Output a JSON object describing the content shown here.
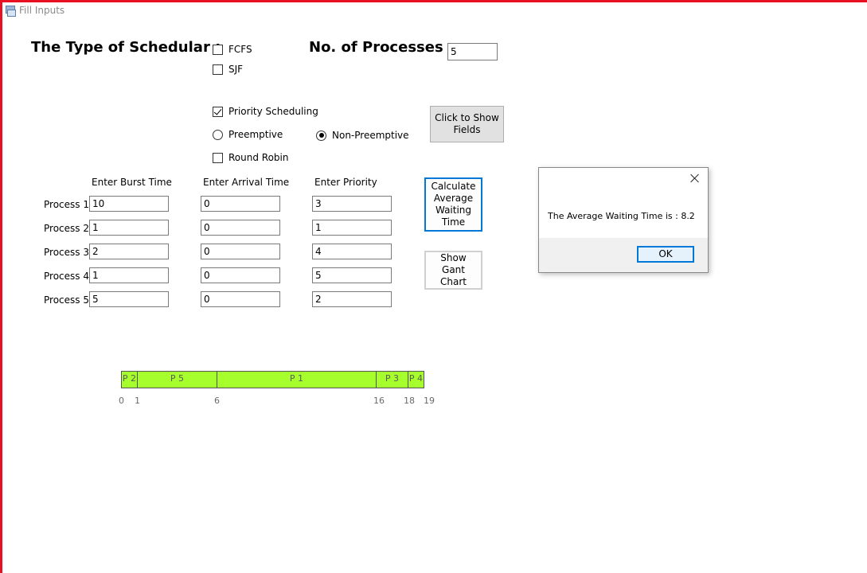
{
  "window": {
    "title": "Fill Inputs"
  },
  "scheduler": {
    "heading": "The Type of Schedular :",
    "options": {
      "fcfs": {
        "label": "FCFS",
        "checked": false
      },
      "sjf": {
        "label": "SJF",
        "checked": false
      },
      "priority": {
        "label": "Priority Scheduling",
        "checked": true
      },
      "preemptive": {
        "label": "Preemptive",
        "selected": false
      },
      "non_preemptive": {
        "label": "Non-Preemptive",
        "selected": true
      },
      "round_robin": {
        "label": "Round Robin",
        "checked": false
      }
    }
  },
  "processes_count": {
    "heading": "No. of Processes :",
    "value": "5"
  },
  "buttons": {
    "show_fields": "Click to Show Fields",
    "calculate": "Calculate Average Waiting Time",
    "gantt": "Show Gant Chart"
  },
  "table": {
    "headers": {
      "burst": "Enter Burst Time",
      "arrival": "Enter Arrival Time",
      "priority": "Enter Priority"
    },
    "rows": [
      {
        "label": "Process 1",
        "burst": "10",
        "arrival": "0",
        "priority": "3"
      },
      {
        "label": "Process 2",
        "burst": "1",
        "arrival": "0",
        "priority": "1"
      },
      {
        "label": "Process 3",
        "burst": "2",
        "arrival": "0",
        "priority": "4"
      },
      {
        "label": "Process 4",
        "burst": "1",
        "arrival": "0",
        "priority": "5"
      },
      {
        "label": "Process 5",
        "burst": "5",
        "arrival": "0",
        "priority": "2"
      }
    ]
  },
  "gantt": {
    "segments": [
      {
        "label": "P 2",
        "start": 0,
        "end": 1
      },
      {
        "label": "P 5",
        "start": 1,
        "end": 6
      },
      {
        "label": "P 1",
        "start": 6,
        "end": 16
      },
      {
        "label": "P 3",
        "start": 16,
        "end": 18
      },
      {
        "label": "P 4",
        "start": 18,
        "end": 19
      }
    ],
    "ticks": [
      "0",
      "1",
      "6",
      "16",
      "18",
      "19"
    ],
    "color": "#a6ff2c"
  },
  "dialog": {
    "message": "The Average Waiting Time is : 8.2",
    "ok_label": "OK"
  }
}
